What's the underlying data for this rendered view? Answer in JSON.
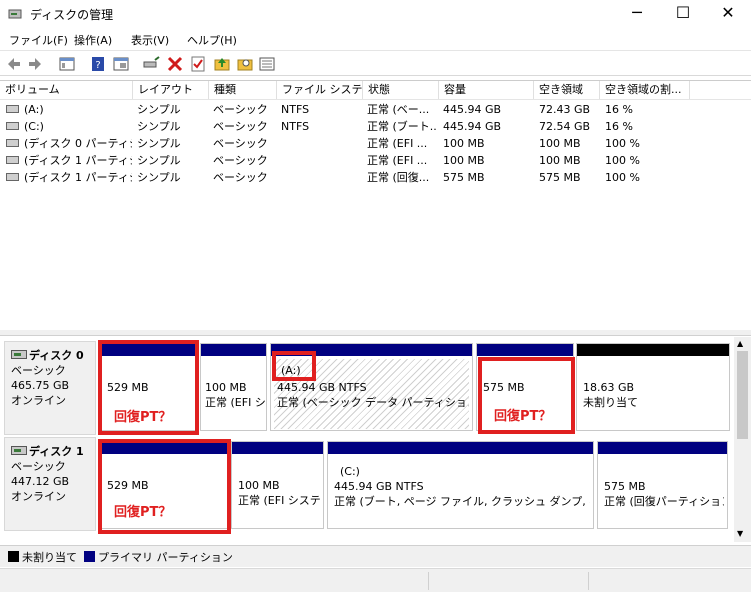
{
  "window": {
    "title": "ディスクの管理"
  },
  "menu": [
    {
      "label": "ファイル(F)"
    },
    {
      "label": "操作(A)"
    },
    {
      "label": "表示(V)"
    },
    {
      "label": "ヘルプ(H)"
    }
  ],
  "columns": [
    "ボリューム",
    "レイアウト",
    "種類",
    "ファイル システム",
    "状態",
    "容量",
    "空き領域",
    "空き領域の割..."
  ],
  "volumes": [
    {
      "name": "(A:)",
      "layout": "シンプル",
      "type": "ベーシック",
      "fs": "NTFS",
      "status": "正常 (ベー...",
      "capacity": "445.94 GB",
      "free": "72.43 GB",
      "pct": "16 %"
    },
    {
      "name": "(C:)",
      "layout": "シンプル",
      "type": "ベーシック",
      "fs": "NTFS",
      "status": "正常 (ブート...",
      "capacity": "445.94 GB",
      "free": "72.54 GB",
      "pct": "16 %"
    },
    {
      "name": "(ディスク 0 パーティシ...",
      "layout": "シンプル",
      "type": "ベーシック",
      "fs": "",
      "status": "正常 (EFI ...",
      "capacity": "100 MB",
      "free": "100 MB",
      "pct": "100 %"
    },
    {
      "name": "(ディスク 1 パーティシ...",
      "layout": "シンプル",
      "type": "ベーシック",
      "fs": "",
      "status": "正常 (EFI ...",
      "capacity": "100 MB",
      "free": "100 MB",
      "pct": "100 %"
    },
    {
      "name": "(ディスク 1 パーティシ...",
      "layout": "シンプル",
      "type": "ベーシック",
      "fs": "",
      "status": "正常 (回復...",
      "capacity": "575 MB",
      "free": "575 MB",
      "pct": "100 %"
    }
  ],
  "disks": [
    {
      "name": "ディスク 0",
      "type": "ベーシック",
      "size": "465.75 GB",
      "state": "オンライン",
      "partitions": [
        {
          "line1": "",
          "line2": "529 MB",
          "line3": ""
        },
        {
          "line1": "",
          "line2": "100 MB",
          "line3": "正常 (EFI シ"
        },
        {
          "line1": "(A:)",
          "line2": "445.94 GB NTFS",
          "line3": "正常 (ベーシック データ パーティション)"
        },
        {
          "line1": "",
          "line2": "575 MB",
          "line3": ""
        },
        {
          "line1": "",
          "line2": "18.63 GB",
          "line3": "未割り当て"
        }
      ]
    },
    {
      "name": "ディスク 1",
      "type": "ベーシック",
      "size": "447.12 GB",
      "state": "オンライン",
      "partitions": [
        {
          "line1": "",
          "line2": "529 MB",
          "line3": ""
        },
        {
          "line1": "",
          "line2": "100 MB",
          "line3": "正常 (EFI システ"
        },
        {
          "line1": "(C:)",
          "line2": "445.94 GB NTFS",
          "line3": "正常 (ブート, ページ ファイル, クラッシュ ダンプ, ベーシック"
        },
        {
          "line1": "",
          "line2": "575 MB",
          "line3": "正常 (回復パーティション)"
        }
      ]
    }
  ],
  "annotation": "回復PT？",
  "legend": [
    {
      "label": "未割り当て",
      "color": "#000000"
    },
    {
      "label": "プライマリ パーティション",
      "color": "#000080"
    }
  ],
  "colors": {
    "primary": "#000080",
    "unallocated": "#000000",
    "highlight": "#e02020"
  }
}
